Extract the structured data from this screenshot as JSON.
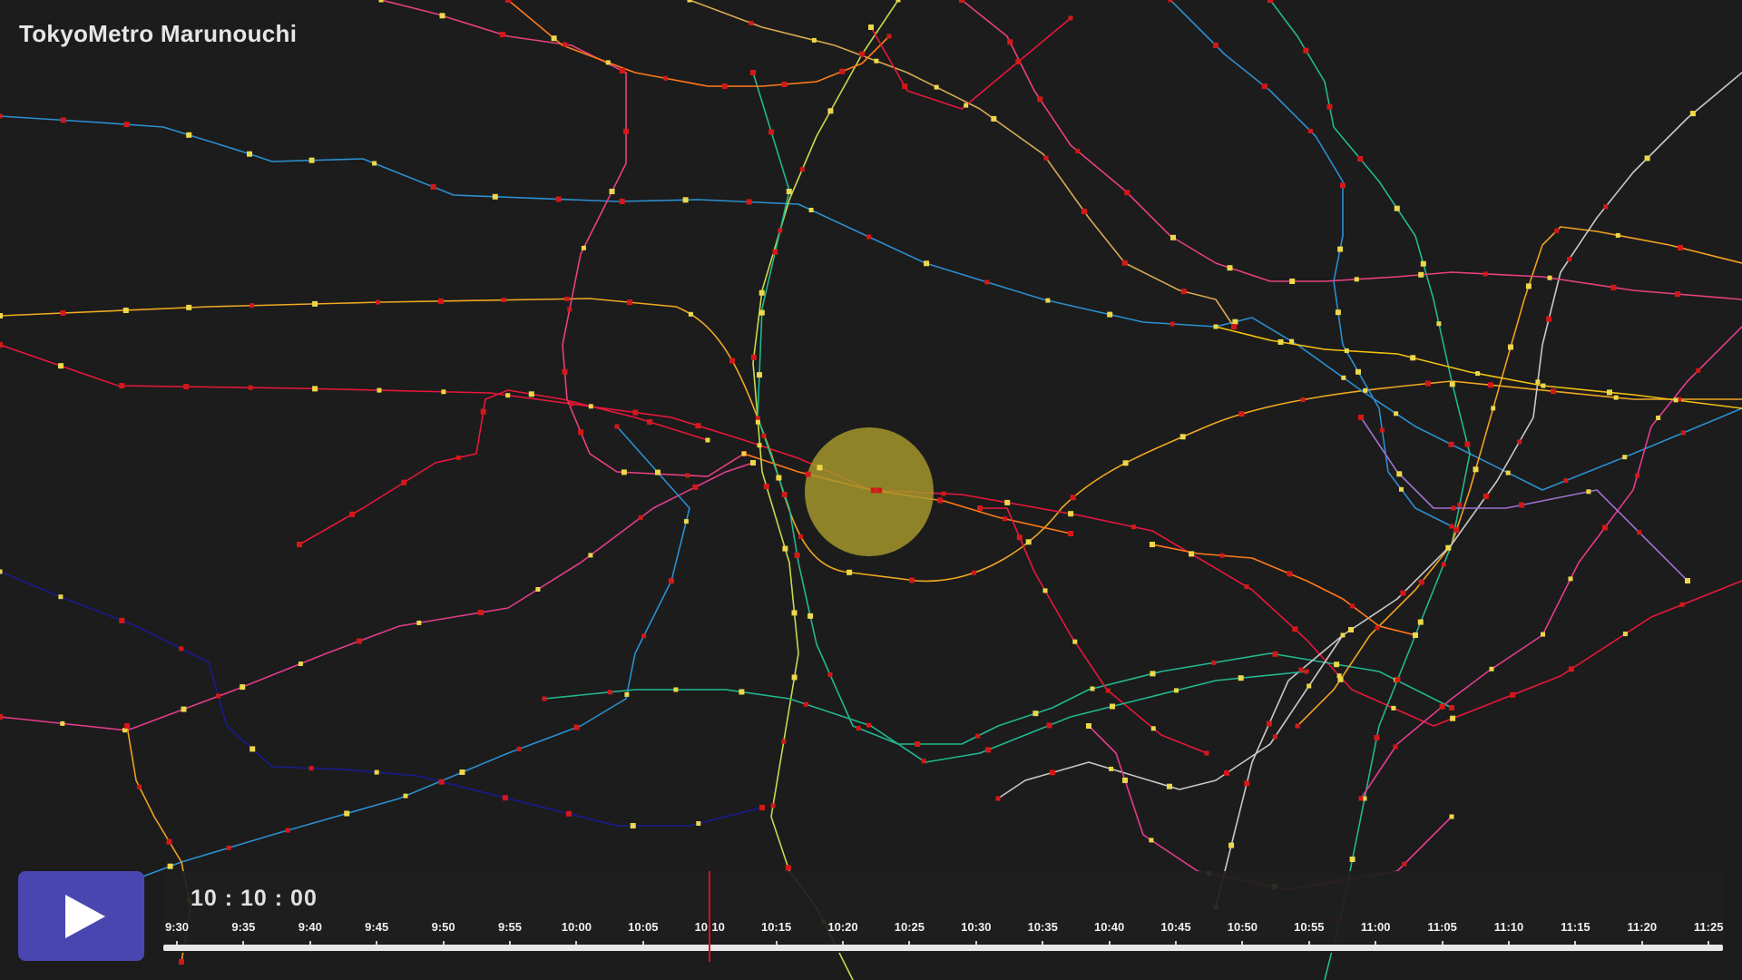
{
  "app": {
    "title": "TokyoMetro Marunouchi"
  },
  "player": {
    "play_icon": "play-icon",
    "clock": "10 : 10 : 00",
    "current_time": "10:10",
    "ticks": [
      "9:30",
      "9:35",
      "9:40",
      "9:45",
      "9:50",
      "9:55",
      "10:00",
      "10:05",
      "10:10",
      "10:15",
      "10:20",
      "10:25",
      "10:30",
      "10:35",
      "10:40",
      "10:45",
      "10:50",
      "10:55",
      "11:00",
      "11:05",
      "11:10",
      "11:15",
      "11:20",
      "11:25"
    ]
  },
  "colors": {
    "background": "#1c1c1c",
    "station_red": "#d41818",
    "station_yellow": "#ecd84a",
    "highlight": "#a89a2c",
    "play_button": "#4a46b0",
    "playhead": "#d01020"
  },
  "map": {
    "line_colors": [
      "#e8173c",
      "#f0a020",
      "#2b8fd0",
      "#22b890",
      "#c8d850",
      "#ff7a18",
      "#e23c8c",
      "#1a1a90",
      "#c8c8c8",
      "#a070d0",
      "#d8a850",
      "#e84080",
      "#6cc040",
      "#f0c010"
    ]
  }
}
